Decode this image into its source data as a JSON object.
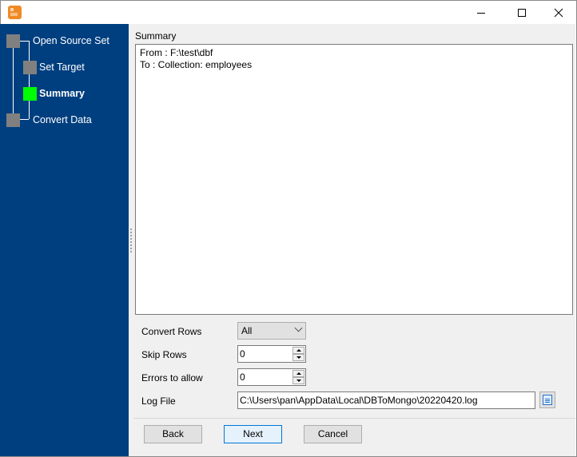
{
  "window": {
    "title": "",
    "app_icon": "dbtomongo-app-icon",
    "controls": {
      "minimize": "minimize-icon",
      "maximize": "maximize-icon",
      "close": "close-icon"
    }
  },
  "sidebar": {
    "steps": [
      {
        "label": "Open Source Set",
        "state": "inactive"
      },
      {
        "label": "Set Target",
        "state": "inactive"
      },
      {
        "label": "Summary",
        "state": "active"
      },
      {
        "label": "Convert Data",
        "state": "inactive"
      }
    ],
    "colors": {
      "background": "#003f7f",
      "active_node": "#00ff00",
      "inactive_node": "#808080"
    }
  },
  "summary": {
    "heading": "Summary",
    "lines": [
      "From : F:\\test\\dbf",
      "To : Collection: employees"
    ]
  },
  "form": {
    "convert_rows": {
      "label": "Convert Rows",
      "value": "All"
    },
    "skip_rows": {
      "label": "Skip Rows",
      "value": "0"
    },
    "errors_to_allow": {
      "label": "Errors to allow",
      "value": "0"
    },
    "log_file": {
      "label": "Log File",
      "value": "C:\\Users\\pan\\AppData\\Local\\DBToMongo\\20220420.log"
    }
  },
  "buttons": {
    "back": "Back",
    "next": "Next",
    "cancel": "Cancel"
  }
}
